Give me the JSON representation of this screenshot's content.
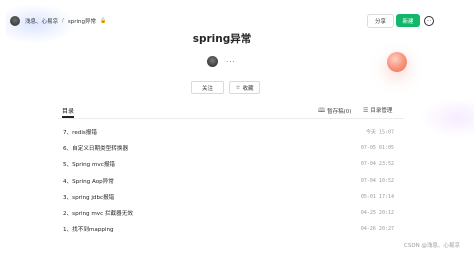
{
  "breadcrumb": {
    "owner": "浅息、心易凉",
    "separator": "/",
    "current": "spring异常",
    "lock_glyph": "🔓"
  },
  "header": {
    "share_label": "分享",
    "new_label": "新建",
    "more_glyph": "⋯"
  },
  "doc": {
    "title": "spring异常",
    "more_dots": "···"
  },
  "actions": {
    "follow_label": "关注",
    "collect_icon": "☆",
    "collect_label": "收藏"
  },
  "toc": {
    "label": "目录",
    "draft_icon": "🕮",
    "draft_label": "暂存稿(0)",
    "manage_icon": "☰",
    "manage_label": "目录管理",
    "items": [
      {
        "name": "7、redis报错",
        "date": "今天 15:07"
      },
      {
        "name": "6、自定义日期类型转换器",
        "date": "07-05 01:05"
      },
      {
        "name": "5、Spring mvc报错",
        "date": "07-04 23:52"
      },
      {
        "name": "4、Spring Aop异常",
        "date": "07-04 10:52"
      },
      {
        "name": "3、spring jdbc报错",
        "date": "05-01 17:14"
      },
      {
        "name": "2、spring mvc 拦截器无效",
        "date": "04-25 20:12"
      },
      {
        "name": "1、找不到mapping",
        "date": "04-26 20:27"
      }
    ]
  },
  "watermark": "CSDN @浅息、心易凉",
  "colors": {
    "accent_green": "#12b76a",
    "orb": "#f79078"
  }
}
